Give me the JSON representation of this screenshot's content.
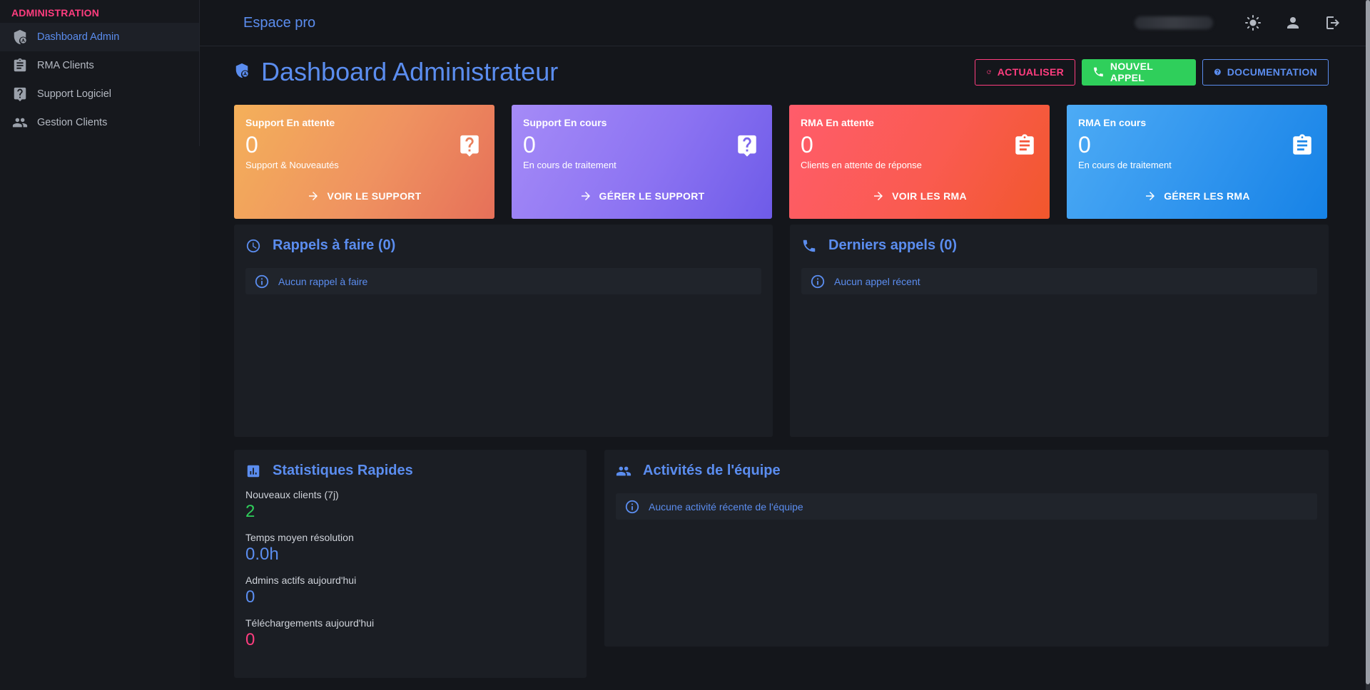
{
  "sidebar": {
    "section": "ADMINISTRATION",
    "items": [
      {
        "label": "Dashboard Admin",
        "icon": "admin-shield-icon"
      },
      {
        "label": "RMA Clients",
        "icon": "clipboard-icon"
      },
      {
        "label": "Support Logiciel",
        "icon": "help-box-icon"
      },
      {
        "label": "Gestion Clients",
        "icon": "people-icon"
      }
    ]
  },
  "topbar": {
    "brand": "Espace pro"
  },
  "header": {
    "title": "Dashboard Administrateur",
    "refresh": "ACTUALISER",
    "new_call": "NOUVEL APPEL",
    "documentation": "DOCUMENTATION"
  },
  "cards": [
    {
      "title": "Support En attente",
      "value": "0",
      "sub": "Support & Nouveautés",
      "link": "VOIR LE SUPPORT",
      "icon": "help-bubble-icon"
    },
    {
      "title": "Support En cours",
      "value": "0",
      "sub": "En cours de traitement",
      "link": "GÉRER LE SUPPORT",
      "icon": "help-bubble-icon"
    },
    {
      "title": "RMA En attente",
      "value": "0",
      "sub": "Clients en attente de réponse",
      "link": "VOIR LES RMA",
      "icon": "clipboard-icon"
    },
    {
      "title": "RMA En cours",
      "value": "0",
      "sub": "En cours de traitement",
      "link": "GÉRER LES RMA",
      "icon": "clipboard-icon"
    }
  ],
  "reminders": {
    "title": "Rappels à faire (0)",
    "empty": "Aucun rappel à faire"
  },
  "calls": {
    "title": "Derniers appels (0)",
    "empty": "Aucun appel récent"
  },
  "stats": {
    "title": "Statistiques Rapides",
    "items": [
      {
        "label": "Nouveaux clients (7j)",
        "value": "2",
        "color": "#2fcf5b"
      },
      {
        "label": "Temps moyen résolution",
        "value": "0.0h",
        "color": "#5b8def"
      },
      {
        "label": "Admins actifs aujourd'hui",
        "value": "0",
        "color": "#5b8def"
      },
      {
        "label": "Téléchargements aujourd'hui",
        "value": "0",
        "color": "#ff3d7f"
      }
    ]
  },
  "team": {
    "title": "Activités de l'équipe",
    "empty": "Aucune activité récente de l'équipe"
  }
}
